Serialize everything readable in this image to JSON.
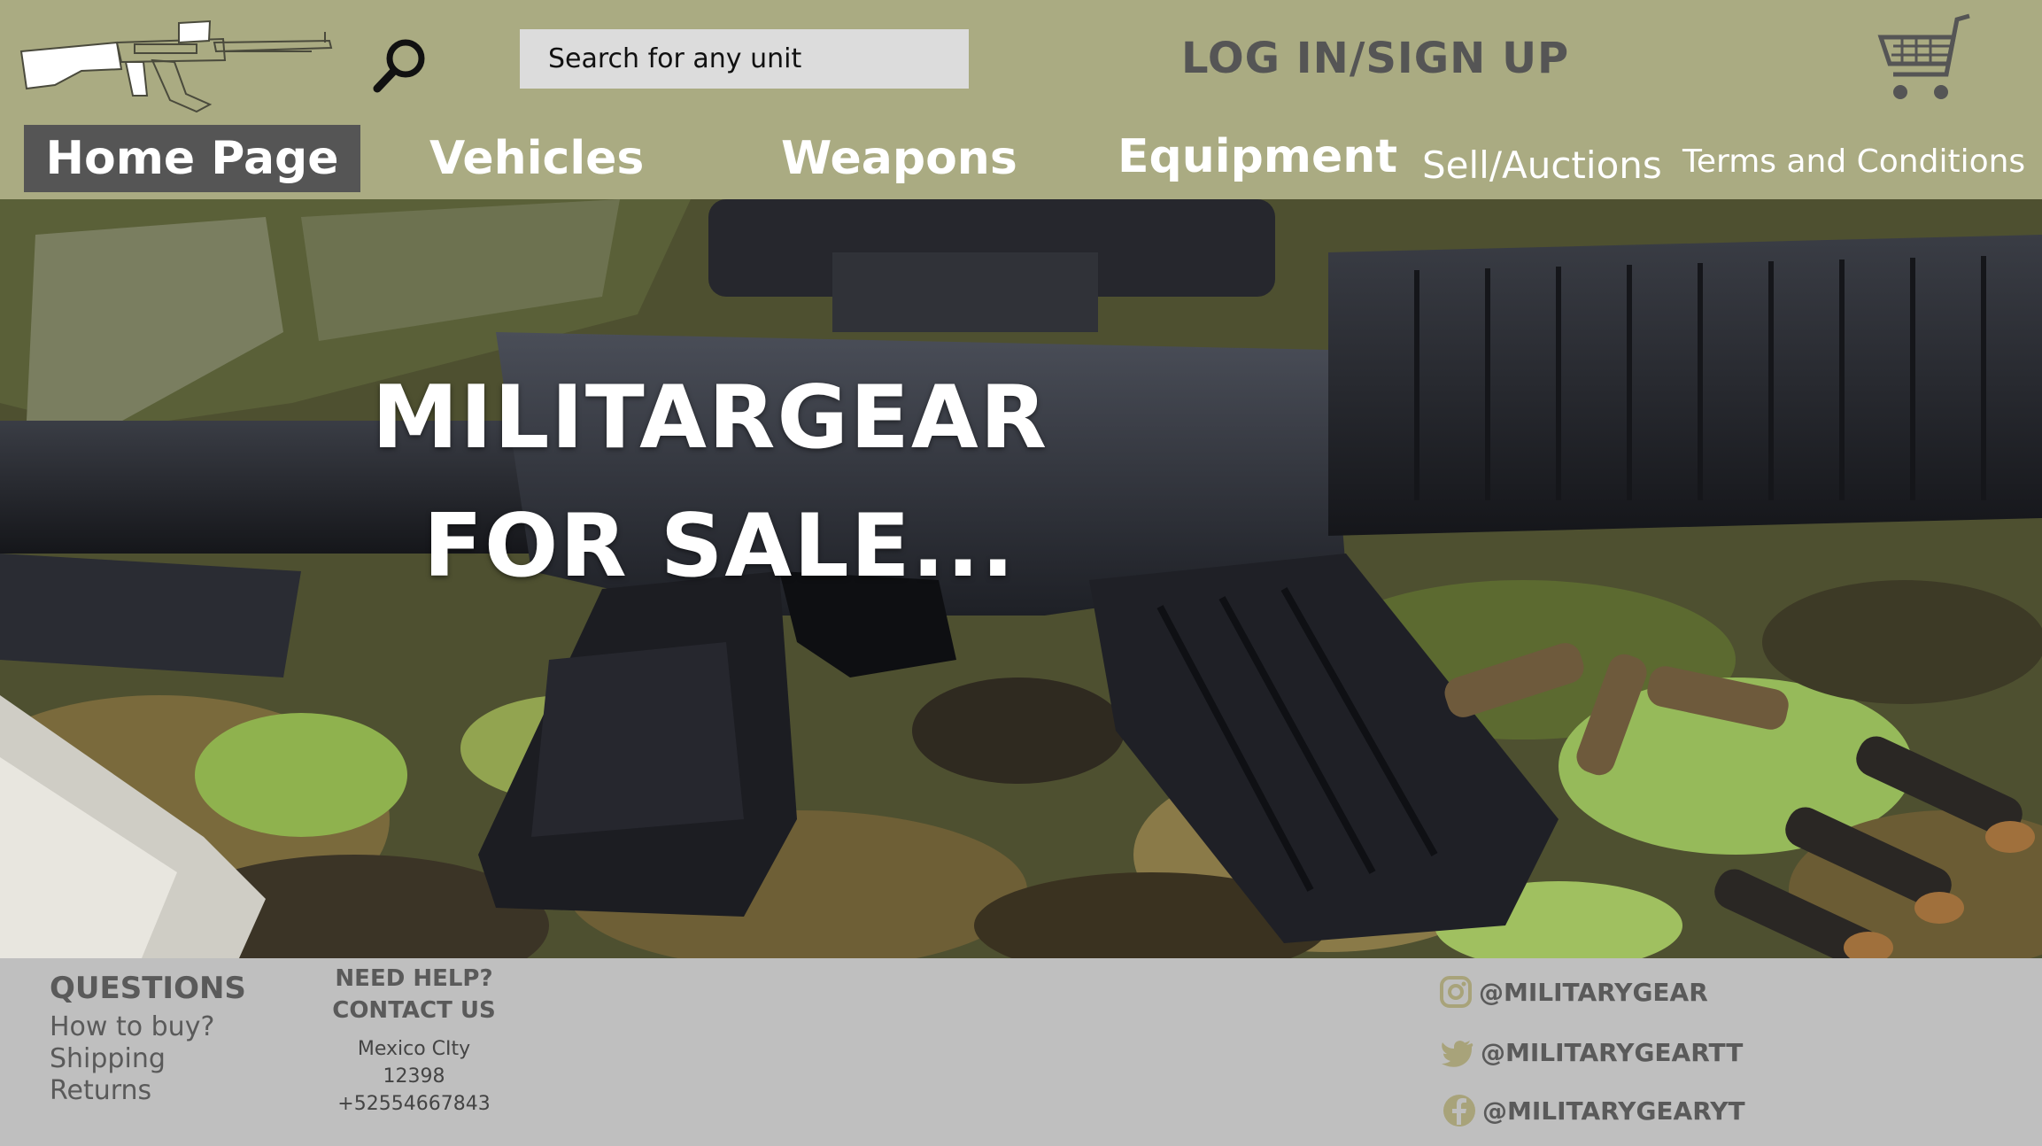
{
  "header": {
    "logo_icon": "rifle-logo-icon",
    "search_icon": "magnifier-icon",
    "search": {
      "placeholder": "Search for any unit",
      "value": ""
    },
    "login_label": "LOG IN/SIGN UP",
    "cart_icon": "shopping-cart-icon"
  },
  "nav": {
    "home": "Home Page",
    "vehicles": "Vehicles",
    "weapons": "Weapons",
    "equipment": "Equipment",
    "sell": "Sell/Auctions",
    "terms": "Terms and Conditions"
  },
  "hero": {
    "title_line1": "MILITARGEAR",
    "title_line2": "FOR SALE..."
  },
  "footer": {
    "questions": {
      "heading": "QUESTIONS",
      "links": [
        "How to buy?",
        "Shipping",
        "Returns"
      ]
    },
    "help": {
      "heading1": "NEED HELP?",
      "heading2": "CONTACT US",
      "city": "Mexico CIty",
      "zip": "12398",
      "phone": "+52554667843"
    },
    "social": [
      {
        "icon": "instagram-icon",
        "handle": "@MILITARYGEAR"
      },
      {
        "icon": "twitter-icon",
        "handle": "@MILITARYGEARTT"
      },
      {
        "icon": "facebook-icon",
        "handle": "@MILITARYGEARYT"
      }
    ]
  },
  "colors": {
    "header_bg": "#aaab82",
    "nav_active_bg": "#555555",
    "footer_bg": "#bfbfbf",
    "search_bg": "#dcdcdc"
  }
}
